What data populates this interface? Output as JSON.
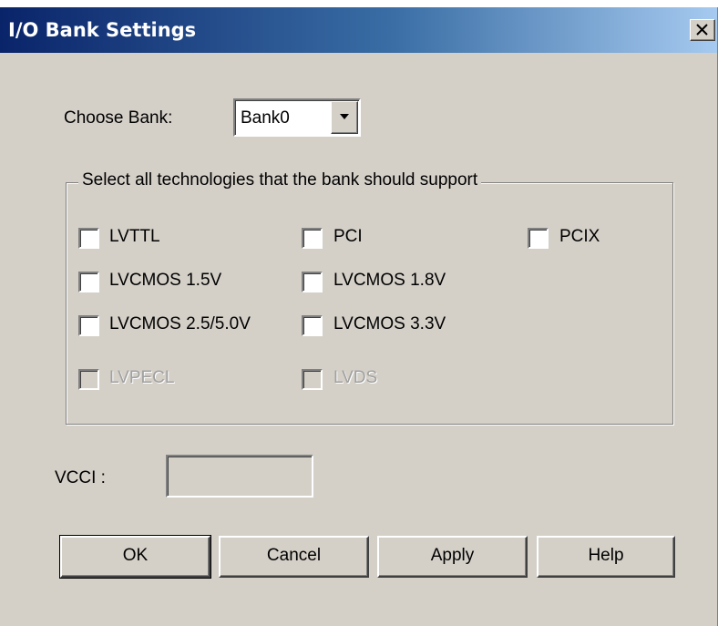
{
  "window": {
    "title": "I/O Bank Settings"
  },
  "bank": {
    "label": "Choose Bank:",
    "selected": "Bank0"
  },
  "technologies": {
    "group_title": "Select all technologies that the bank should support",
    "items": [
      {
        "label": "LVTTL",
        "checked": false,
        "enabled": true
      },
      {
        "label": "PCI",
        "checked": false,
        "enabled": true
      },
      {
        "label": "PCIX",
        "checked": false,
        "enabled": true
      },
      {
        "label": "LVCMOS 1.5V",
        "checked": false,
        "enabled": true
      },
      {
        "label": "LVCMOS 1.8V",
        "checked": false,
        "enabled": true
      },
      {
        "label": "LVCMOS 2.5/5.0V",
        "checked": false,
        "enabled": true
      },
      {
        "label": "LVCMOS 3.3V",
        "checked": false,
        "enabled": true
      },
      {
        "label": "LVPECL",
        "checked": false,
        "enabled": false
      },
      {
        "label": "LVDS",
        "checked": false,
        "enabled": false
      }
    ]
  },
  "vcci": {
    "label": "VCCI :",
    "value": ""
  },
  "buttons": {
    "ok": "OK",
    "cancel": "Cancel",
    "apply": "Apply",
    "help": "Help"
  },
  "icons": {
    "close": "close-icon",
    "dropdown": "chevron-down-icon"
  },
  "colors": {
    "face": "#d4d0c8",
    "title_start": "#0a246a",
    "title_end": "#a6caf0"
  }
}
